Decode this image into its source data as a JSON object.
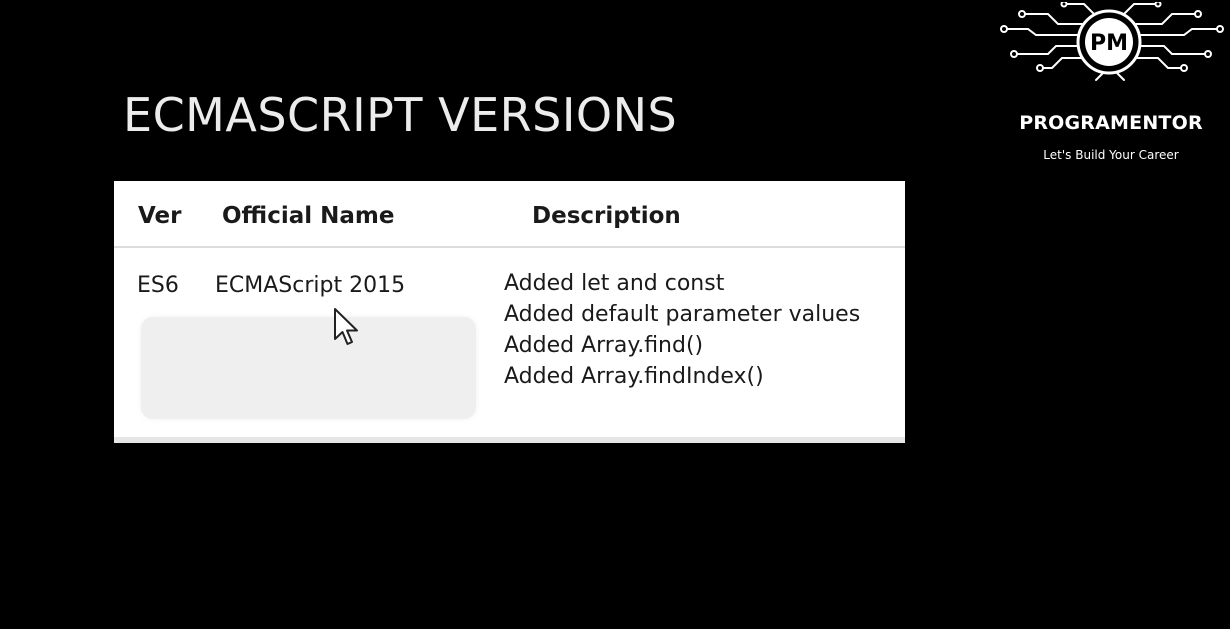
{
  "slide": {
    "title": "ECMASCRIPT VERSIONS"
  },
  "table": {
    "headers": {
      "ver": "Ver",
      "official_name": "Official Name",
      "description": "Description"
    },
    "rows": [
      {
        "ver": "ES6",
        "official_name": "ECMAScript 2015",
        "description": [
          "Added let and const",
          "Added default parameter values",
          "Added Array.find()",
          "Added Array.findIndex()"
        ]
      }
    ]
  },
  "brand": {
    "logo_text": "PM",
    "name": "PROGRAMENTOR",
    "tagline": "Let's Build Your Career"
  },
  "icons": {
    "cursor": "mouse-pointer-icon",
    "logo": "circuit-logo-icon"
  },
  "colors": {
    "background": "#000000",
    "card": "#ffffff",
    "text": "#1a1a1a",
    "placeholder": "#efefef"
  }
}
